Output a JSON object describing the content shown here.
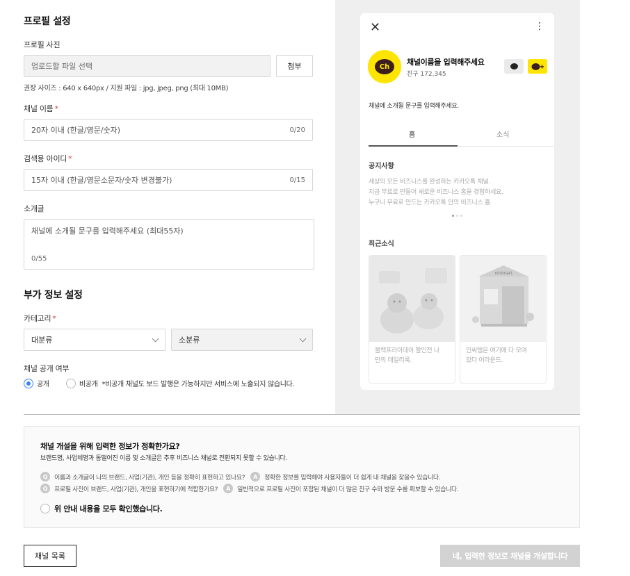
{
  "profile": {
    "section_title": "프로필 설정",
    "photo_label": "프로필 사진",
    "photo_placeholder": "업로드할 파일 선택",
    "attach_button": "첨부",
    "photo_hint": "권장 사이즈 : 640 x 640px / 지원 파일 : jpg, jpeg, png (최대 10MB)",
    "channel_name_label": "채널 이름",
    "channel_name_placeholder": "20자 이내 (한글/영문/숫자)",
    "channel_name_counter": "0/20",
    "search_id_label": "검색용 아이디",
    "search_id_placeholder": "15자 이내 (한글/영문소문자/숫자 변경불가)",
    "search_id_counter": "0/15",
    "intro_label": "소개글",
    "intro_placeholder": "채널에 소개될 문구를 입력해주세요 (최대55자)",
    "intro_counter": "0/55",
    "required_mark": "*"
  },
  "extra": {
    "section_title": "부가 정보 설정",
    "category_label": "카테고리",
    "category_major": "대분류",
    "category_minor": "소분류",
    "visibility_label": "채널 공개 여부",
    "public_option": "공개",
    "private_option": "비공개",
    "private_note": "*비공개 채널도 보드 발행은 가능하지만 서비스에 노출되지 않습니다."
  },
  "preview": {
    "channel_name": "채널이름을 입력해주세요",
    "friends": "친구 172,345",
    "logo_text": "Ch",
    "intro": "채널에 소개될 문구를 입력해주세요.",
    "tab_home": "홈",
    "tab_news": "소식",
    "notice_title": "공지사항",
    "notice_lines": [
      "세상의 모든 비즈니스를 완성하는 카카오톡 채널.",
      "지금 무료로 만들어 새로운 비즈니스 홈을 경험하세요.",
      "누구나 무료로 만드는 카카오톡 안의 비즈니스 홈"
    ],
    "recent_title": "최근소식",
    "cards": [
      {
        "text_1": "블랙프라이데이 할인전 나",
        "text_2": "만의 데일리룩."
      },
      {
        "text_1": "인싸템은 여기에 다 모여",
        "text_2": "있다 어라운드."
      }
    ],
    "shop_sign": "ninimart"
  },
  "confirm": {
    "title": "채널 개설을 위해 입력한 정보가 정확한가요?",
    "subtitle": "브랜드명, 사업체명과 동떨어진 이름 및 소개글은 추후 비즈니스 채널로 전환되지 못할 수 있습니다.",
    "q_badge": "Q",
    "a_badge": "A",
    "q1": "이름과 소개글이 나의 브랜드, 사업(기관), 개인 등을 정확히 표현하고 있나요?",
    "a1": "정확한 정보를 입력해야 사용자들이 더 쉽게 내 채널을 찾을수 있습니다.",
    "q2": "프로필 사진이 브랜드, 사업(기관), 개인을 표현하기에 적합한가요?",
    "a2": "일반적으로 프로필 사진이 포함된 채널이 더 많은 친구 수와 방문 수를 확보할 수 있습니다.",
    "check_label": "위 안내 내용을 모두 확인했습니다."
  },
  "footer": {
    "list_button": "채널 목록",
    "create_button": "네, 입력한 정보로 채널을 개설합니다"
  },
  "colors": {
    "accent_blue": "#3b82f6",
    "kakao_yellow": "#fee500",
    "required_red": "#e03c3c",
    "disabled_grey": "#d2d2d2"
  }
}
